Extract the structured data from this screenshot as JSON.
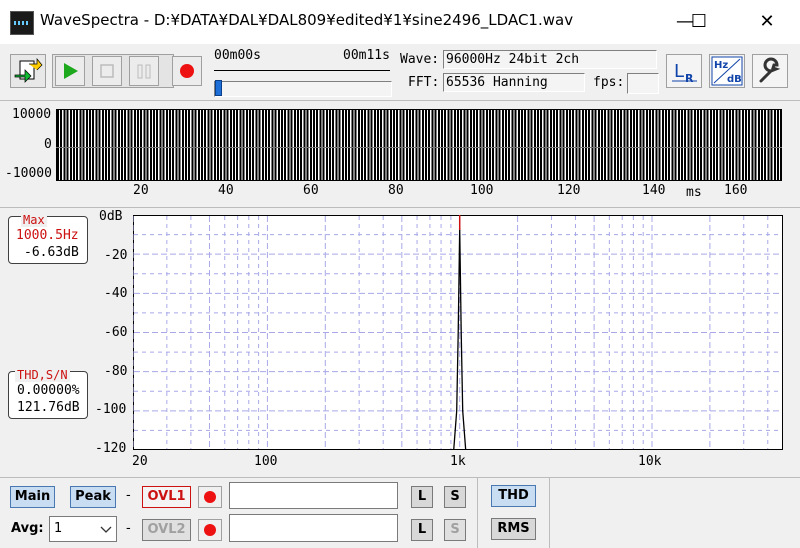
{
  "window": {
    "title": "WaveSpectra - D:¥DATA¥DAL¥DAL809¥edited¥1¥sine2496_LDAC1.wav",
    "minimize": "—",
    "maximize": "☐",
    "close": "✕"
  },
  "toolbar": {
    "time_start": "00m00s",
    "time_end": "00m11s",
    "position_fraction": 0.0,
    "wave_label": "Wave:",
    "wave_value": "96000Hz 24bit 2ch",
    "fft_label": "FFT:",
    "fft_value": "65536 Hanning",
    "fps_label": "fps:",
    "fps_value": "",
    "lr_icon_text": "LR",
    "hzdb_top": "Hz",
    "hzdb_bottom": "dB"
  },
  "waveform": {
    "y_ticks": [
      "10000",
      "0",
      "-10000"
    ],
    "x_ticks": [
      "20",
      "40",
      "60",
      "80",
      "100",
      "120",
      "140",
      "160"
    ],
    "x_unit": "ms"
  },
  "spectrum": {
    "max_title": "Max",
    "max_freq": "1000.5Hz",
    "max_level": "-6.63dB",
    "thd_title": "THD,S/N",
    "thd_value": "0.00000%",
    "sn_value": "121.76dB",
    "y_ticks": [
      "0dB",
      "-20",
      "-40",
      "-60",
      "-80",
      "-100",
      "-120"
    ],
    "x_ticks": [
      "20",
      "100",
      "1k",
      "10k"
    ]
  },
  "bottom": {
    "main_label": "Main",
    "peak_label": "Peak",
    "dash1": "-",
    "dash2": "-",
    "ovl1_label": "OVL1",
    "ovl2_label": "OVL2",
    "l_label": "L",
    "s_label": "S",
    "thd_label": "THD",
    "rms_label": "RMS",
    "avg_label": "Avg:",
    "avg_value": "1",
    "field1": "",
    "field2": ""
  },
  "colors": {
    "accent_red": "#cc1111",
    "plot_grid": "#a8a8e8",
    "play_green": "#1ea81e"
  }
}
